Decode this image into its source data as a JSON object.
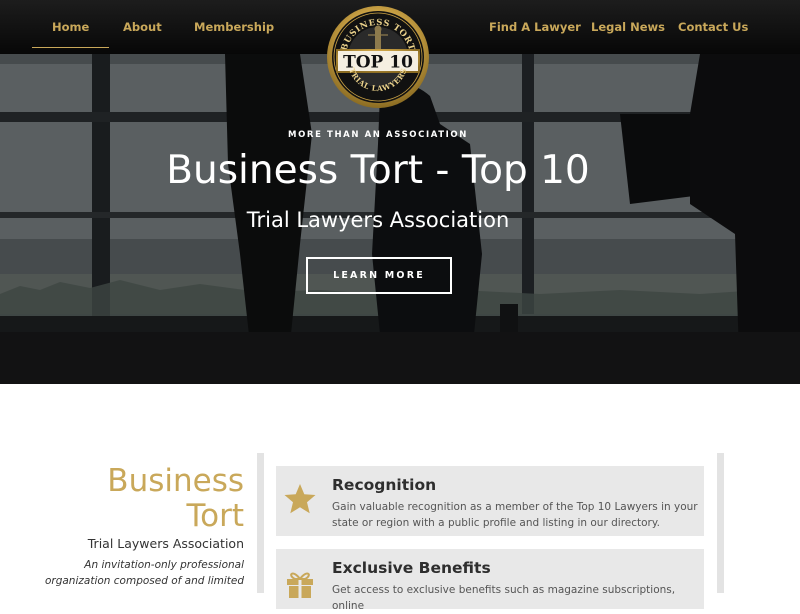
{
  "nav": {
    "left": [
      {
        "label": "Home",
        "active": true
      },
      {
        "label": "About"
      },
      {
        "label": "Membership"
      }
    ],
    "right": [
      {
        "label": "Find A Lawyer"
      },
      {
        "label": "Legal News"
      },
      {
        "label": "Contact Us"
      }
    ]
  },
  "logo": {
    "arc_top": "BUSINESS TORT",
    "center": "TOP 10",
    "arc_bottom": "TRIAL LAWYERS"
  },
  "hero": {
    "eyebrow": "MORE THAN AN ASSOCIATION",
    "title": "Business Tort - Top 10",
    "subtitle": "Trial Lawyers Association",
    "button_label": "LEARN MORE"
  },
  "intro": {
    "title_line1": "Business",
    "title_line2": "Tort",
    "subtitle": "Trial Laywers Association",
    "text": "An invitation-only professional organization composed of and limited"
  },
  "features": [
    {
      "icon": "star-icon",
      "title": "Recognition",
      "text": "Gain valuable recognition as a member of the Top 10 Lawyers in your state or region with a public profile and listing in our directory."
    },
    {
      "icon": "gift-icon",
      "title": "Exclusive Benefits",
      "text": "Get access to exclusive benefits such as magazine subscriptions, online"
    }
  ],
  "colors": {
    "gold": "#c9a85a",
    "nav_bg": "#0d0d0d",
    "card_bg": "#e8e8e8",
    "text_dark": "#2e2e2e"
  }
}
